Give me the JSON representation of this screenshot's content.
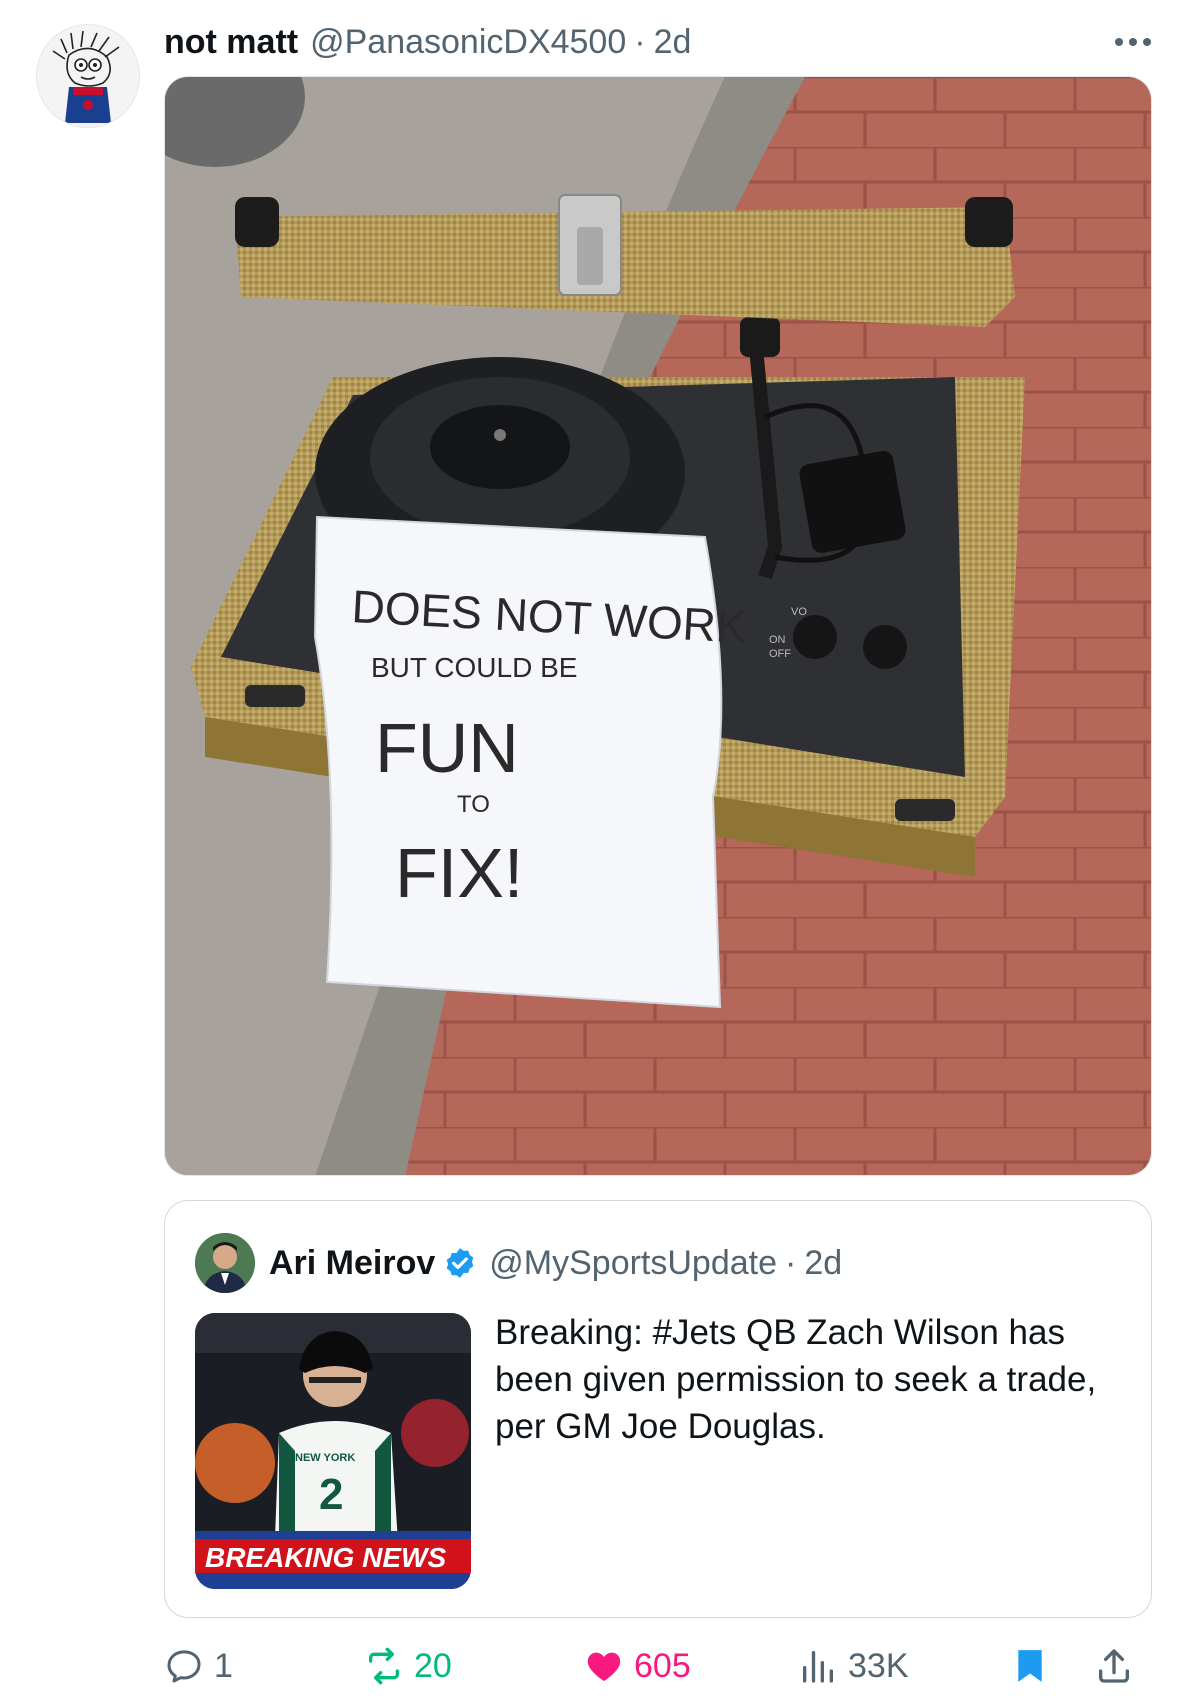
{
  "tweet": {
    "author_name": "not matt",
    "author_handle": "@PanasonicDX4500",
    "separator": "·",
    "time": "2d",
    "photo": {
      "sign_lines": [
        "DOES NOT WORK",
        "BUT COULD BE",
        "FUN",
        "TO",
        "FIX!"
      ],
      "knob_labels": [
        "ON",
        "OFF",
        "VO"
      ]
    }
  },
  "quote": {
    "author_name": "Ari Meirov",
    "author_handle": "@MySportsUpdate",
    "separator": "·",
    "time": "2d",
    "text": "Breaking: #Jets QB Zach Wilson has been given permission to seek a trade, per GM Joe Douglas.",
    "thumbnail": {
      "banner": "BREAKING NEWS",
      "jersey_text": "NEW YORK",
      "jersey_number": "2"
    }
  },
  "actions": {
    "replies": "1",
    "reposts": "20",
    "likes": "605",
    "views": "33K"
  },
  "colors": {
    "text_primary": "#0f1419",
    "text_secondary": "#536471",
    "repost_green": "#00ba7c",
    "like_pink": "#f91880",
    "bookmark_blue": "#1d9bf0",
    "verified_blue": "#1d9bf0"
  },
  "icons": [
    "more-icon",
    "verified-icon",
    "reply-icon",
    "repost-icon",
    "heart-icon",
    "views-icon",
    "bookmark-icon",
    "share-icon"
  ]
}
